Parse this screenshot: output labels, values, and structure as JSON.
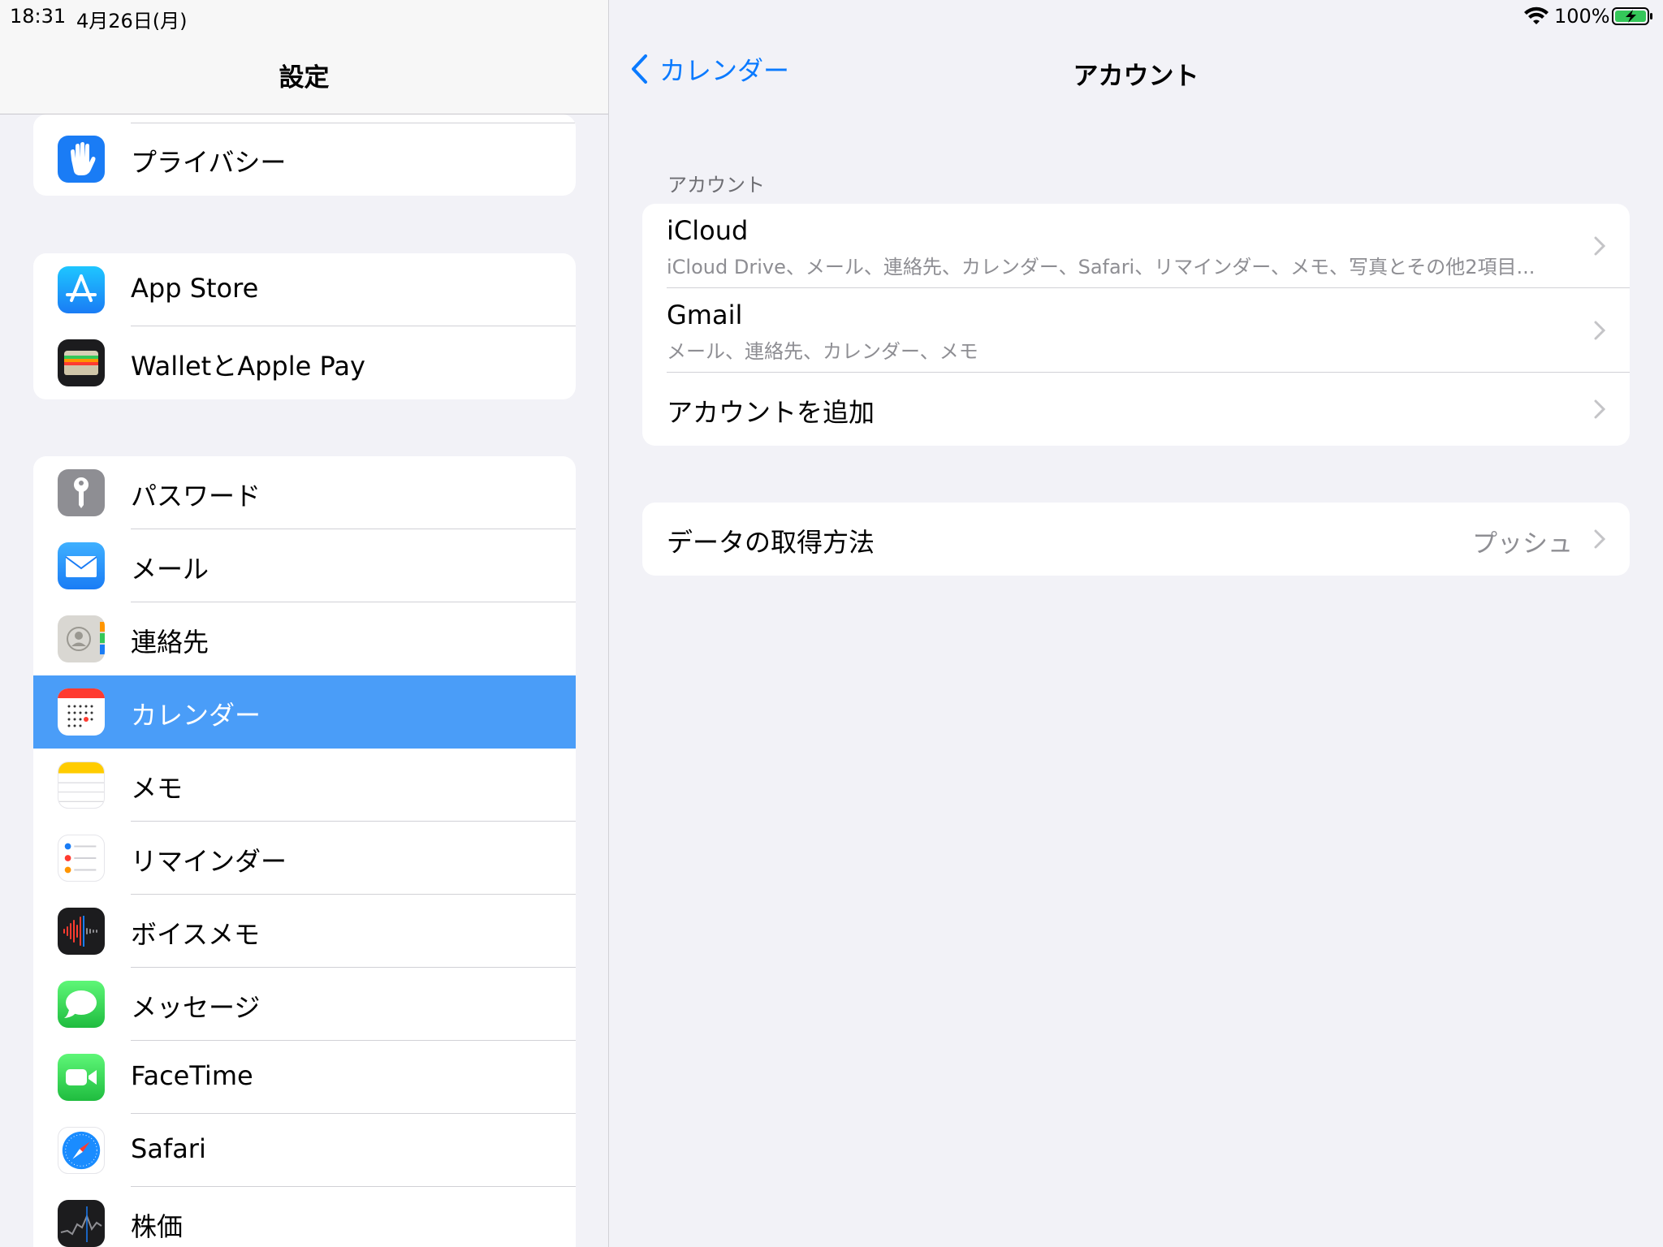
{
  "status_bar": {
    "time": "18:31",
    "date": "4月26日(月)",
    "battery_percent": "100%",
    "battery_level": 1.0,
    "charging": true
  },
  "sidebar": {
    "title": "設定",
    "items": [
      {
        "label": "プライバシー",
        "icon": "privacy-hand-icon",
        "color": "#1a7cf5"
      },
      {
        "label": "App Store",
        "icon": "app-store-icon",
        "color": "#1a8cff"
      },
      {
        "label": "WalletとApple Pay",
        "icon": "wallet-icon",
        "color": "#1c1c1e"
      },
      {
        "label": "パスワード",
        "icon": "key-icon",
        "color": "#8e8e93"
      },
      {
        "label": "メール",
        "icon": "mail-icon",
        "color": "#1e90ff"
      },
      {
        "label": "連絡先",
        "icon": "contacts-icon",
        "color": "#d9d7d2"
      },
      {
        "label": "カレンダー",
        "icon": "calendar-icon",
        "color": "#ffffff",
        "selected": true
      },
      {
        "label": "メモ",
        "icon": "notes-icon",
        "color": "#ffcc00"
      },
      {
        "label": "リマインダー",
        "icon": "reminders-icon",
        "color": "#ffffff"
      },
      {
        "label": "ボイスメモ",
        "icon": "voice-memo-icon",
        "color": "#1c1c1e"
      },
      {
        "label": "メッセージ",
        "icon": "messages-icon",
        "color": "#34c759"
      },
      {
        "label": "FaceTime",
        "icon": "facetime-icon",
        "color": "#34c759"
      },
      {
        "label": "Safari",
        "icon": "safari-compass-icon",
        "color": "#1a8cff"
      },
      {
        "label": "株価",
        "icon": "stocks-icon",
        "color": "#1c1c1e"
      }
    ],
    "selected_color": "#4a9df8"
  },
  "detail": {
    "back_label": "カレンダー",
    "title": "アカウント",
    "section_header": "アカウント",
    "accounts": [
      {
        "title": "iCloud",
        "subtitle": "iCloud Drive、メール、連絡先、カレンダー、Safari、リマインダー、メモ、写真とその他2項目..."
      },
      {
        "title": "Gmail",
        "subtitle": "メール、連絡先、カレンダー、メモ"
      },
      {
        "title": "アカウントを追加"
      }
    ],
    "fetch": {
      "label": "データの取得方法",
      "value": "プッシュ"
    },
    "accent_color": "#0a7aff"
  }
}
